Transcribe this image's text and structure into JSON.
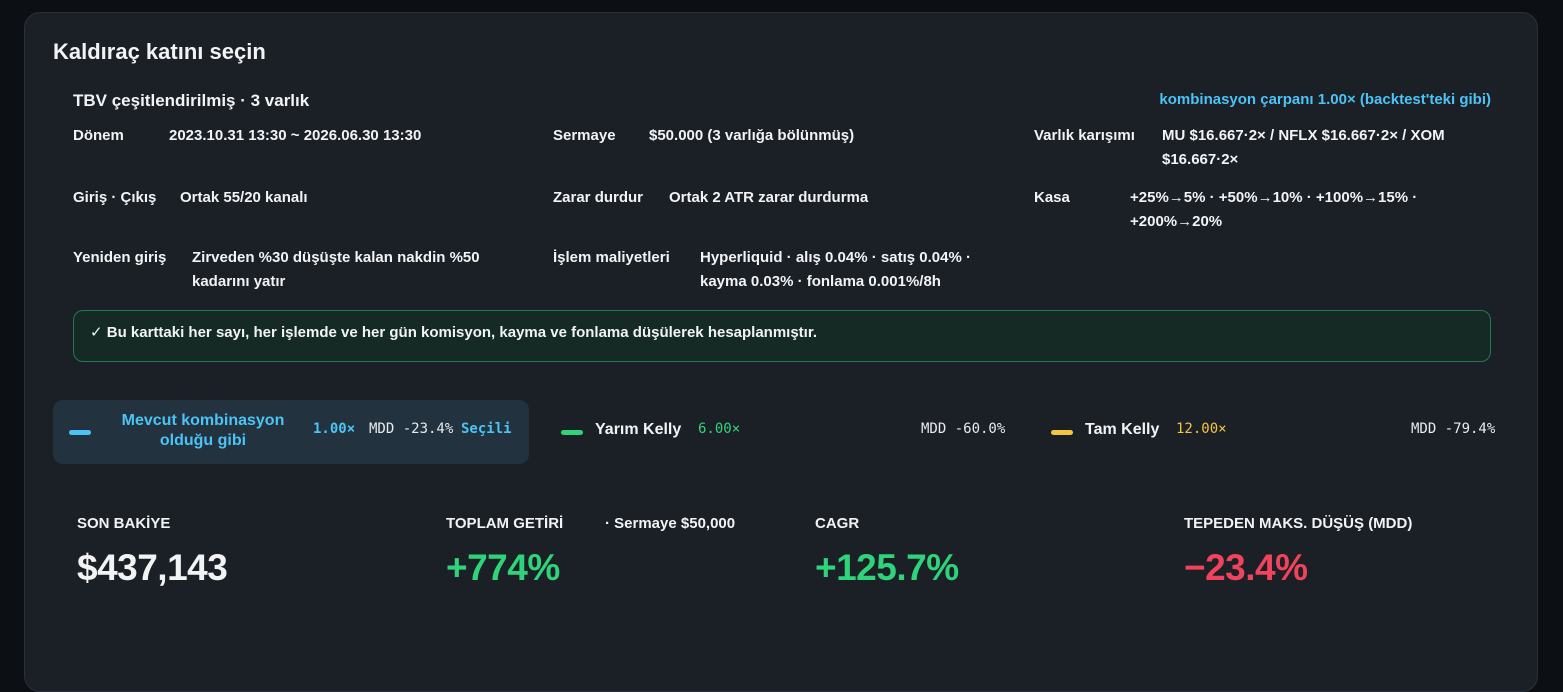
{
  "card": {
    "title": "Kaldıraç katını seçin",
    "subtitle": "TBV çeşitlendirilmiş · 3 varlık",
    "multiplier_note": "kombinasyon çarpanı 1.00× (backtest'teki gibi)"
  },
  "details": {
    "period_label": "Dönem",
    "period_value": "2023.10.31 13:30 ~ 2026.06.30 13:30",
    "capital_label": "Sermaye",
    "capital_value": "$50.000 (3 varlığa bölünmüş)",
    "mix_label": "Varlık karışımı",
    "mix_value": "MU $16.667·2× / NFLX $16.667·2× / XOM $16.667·2×",
    "entry_label": "Giriş · Çıkış",
    "entry_value": "Ortak 55/20 kanalı",
    "stop_label": "Zarar durdur",
    "stop_value": "Ortak 2 ATR zarar durdurma",
    "vault_label": "Kasa",
    "vault_value": "+25%→5% · +50%→10% · +100%→15% · +200%→20%",
    "reentry_label": "Yeniden giriş",
    "reentry_value": "Zirveden %30 düşüşte kalan nakdin %50 kadarını yatır",
    "costs_label": "İşlem maliyetleri",
    "costs_value": "Hyperliquid · alış 0.04% · satış 0.04% · kayma 0.03% · fonlama 0.001%/8h"
  },
  "notice": "✓ Bu karttaki her sayı, her işlemde ve her gün komisyon, kayma ve fonlama düşülerek hesaplanmıştır.",
  "options": [
    {
      "name": "Mevcut kombinasyon olduğu gibi",
      "leverage": "1.00×",
      "mdd": "MDD -23.4%",
      "status": "Seçili",
      "color": "#4cc3f5"
    },
    {
      "name": "Yarım Kelly",
      "leverage": "6.00×",
      "mdd": "MDD -60.0%",
      "color": "#2fd47a"
    },
    {
      "name": "Tam Kelly",
      "leverage": "12.00×",
      "mdd": "MDD -79.4%",
      "color": "#f5c542"
    }
  ],
  "stats": {
    "final_balance_label": "SON BAKİYE",
    "final_balance_value": "$437,143",
    "total_return_label": "TOPLAM GETİRİ",
    "total_return_note": "· Sermaye $50,000",
    "total_return_value": "+774%",
    "cagr_label": "CAGR",
    "cagr_value": "+125.7%",
    "mdd_label": "TEPEDEN MAKS. DÜŞÜŞ (MDD)",
    "mdd_value": "−23.4%"
  },
  "colors": {
    "accent_blue": "#4cc3f5",
    "positive_green": "#2fd47a",
    "negative_red": "#f0435c",
    "kelly_yellow": "#f5c542"
  }
}
